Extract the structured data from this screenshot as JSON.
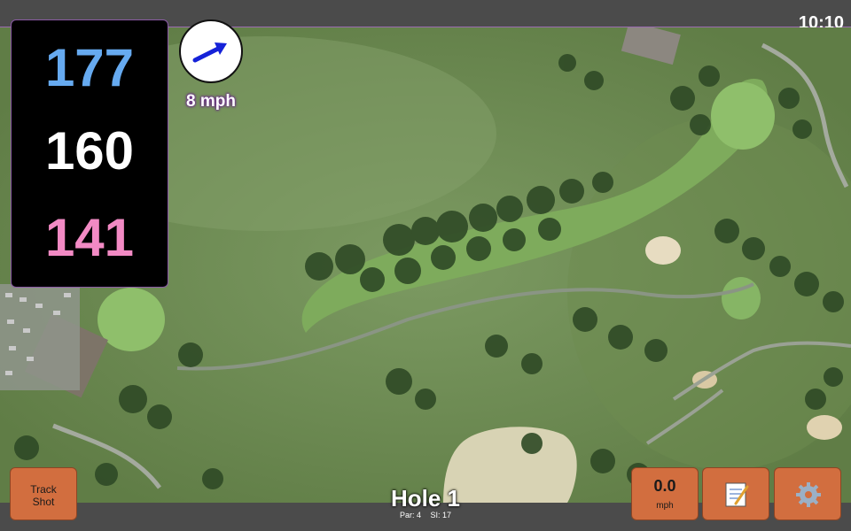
{
  "status_bar": {
    "time": "10:10"
  },
  "distances": {
    "back": "177",
    "middle": "160",
    "front": "141"
  },
  "colors": {
    "back": "#66aaf0",
    "middle": "#ffffff",
    "front": "#f28ac4",
    "button": "#d26e3f",
    "accent": "#9b6bb0"
  },
  "wind": {
    "speed": "8 mph",
    "direction_icon": "arrow-icon"
  },
  "buttons": {
    "track_shot": {
      "line1": "Track",
      "line2": "Shot"
    },
    "speed": {
      "value": "0.0",
      "unit": "mph"
    },
    "notes_icon": "memo-icon",
    "settings_icon": "gear-icon"
  },
  "hole": {
    "title": "Hole 1",
    "par": "Par: 4",
    "si": "SI: 17"
  }
}
